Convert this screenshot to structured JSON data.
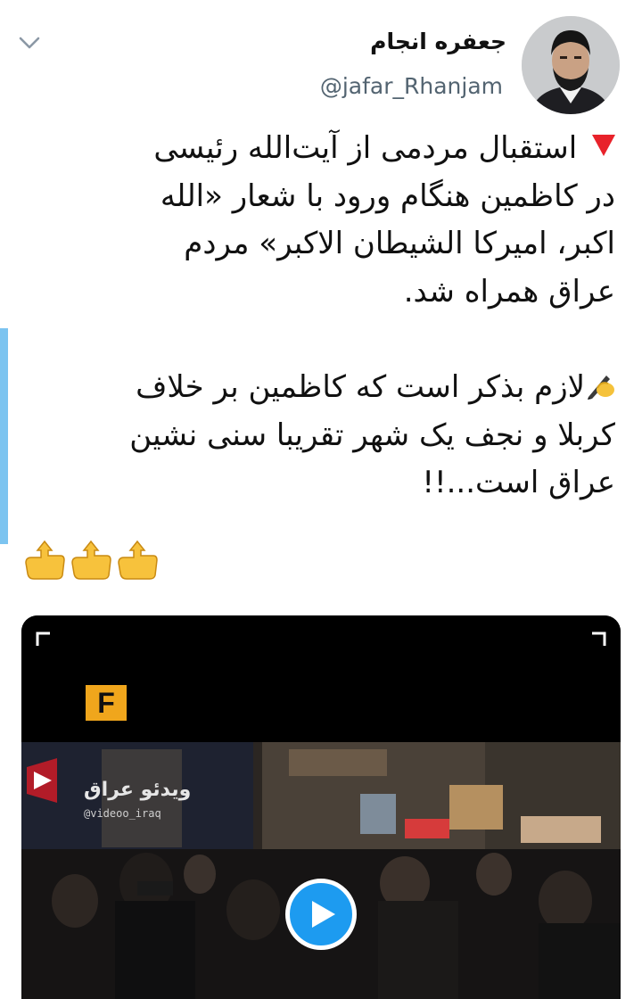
{
  "tweet": {
    "author": {
      "display_name": "جعفره انجام",
      "handle": "@jafar_Rhanjam"
    },
    "text_lines_p1": [
      "استقبال مردمی از آیت‌الله رئیسی",
      "در کاظمین هنگام ورود با شعار «الله",
      "اکبر، امیرکا الشیطان الاکبر» مردم",
      "عراق همراه شد."
    ],
    "text_lines_p2": [
      "لازم بذکر است که کاظمین بر خلاف",
      "کربلا و نجف یک شهر تقریبا سنی نشین",
      "عراق است...!!"
    ],
    "icons": {
      "menu": "chevron-down-icon",
      "bullet_1": "red-triangle-icon",
      "bullet_2": "writing-hand-icon",
      "pointers": "backhand-index-pointing-up-icon",
      "play": "play-icon"
    },
    "media": {
      "type": "video",
      "overlay_logo": "F",
      "overlay_channel": "ویدئو عراق",
      "overlay_channel_sub": "@videoo_iraq"
    }
  },
  "colors": {
    "accent": "#1d9bf0",
    "handle": "#536471",
    "triangle": "#e8222a",
    "thread_bar": "#7cc4f0"
  }
}
